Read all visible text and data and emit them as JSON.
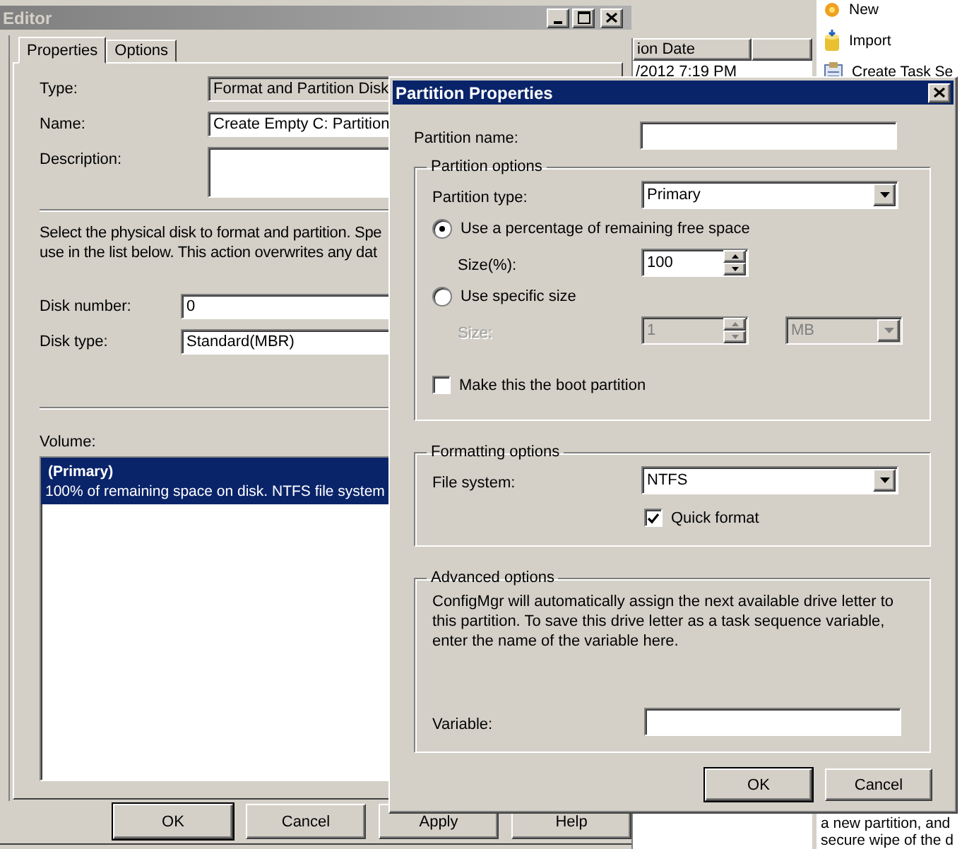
{
  "background": {
    "actions": [
      {
        "label": "New"
      },
      {
        "label": "Import"
      },
      {
        "label": "Create Task Se"
      }
    ],
    "list": {
      "columns": [
        "ion Date"
      ],
      "rows": [
        "/2012 7:19 PM"
      ]
    },
    "description": [
      "a new partition, and",
      "secure wipe of the d"
    ]
  },
  "editor": {
    "title": "Editor",
    "tabs": [
      {
        "label": "Properties",
        "selected": true
      },
      {
        "label": "Options",
        "selected": false
      }
    ],
    "fields": [
      {
        "label": "Type:",
        "value": "Format and Partition Disk",
        "readonly": true,
        "multiline": false
      },
      {
        "label": "Name:",
        "value": "Create Empty C: Partition",
        "readonly": false,
        "multiline": false
      },
      {
        "label": "Description:",
        "readonly": false,
        "multiline": true
      }
    ],
    "instructions": [
      "Select the physical disk to format and partition. Spe",
      "use in the list below. This action overwrites any dat"
    ],
    "disk_fields": [
      {
        "label": "Disk number:",
        "value": "0"
      },
      {
        "label": "Disk type:",
        "value": "Standard(MBR)"
      }
    ],
    "volume": {
      "label": "Volume:",
      "items": [
        {
          "title": "(Primary)",
          "detail": "100% of remaining space on disk. NTFS file system",
          "selected": true
        }
      ]
    },
    "buttons": [
      "OK",
      "Cancel",
      "Apply",
      "Help"
    ]
  },
  "dialog": {
    "title": "Partition Properties",
    "name_label": "Partition name:",
    "groups": [
      {
        "title": "Partition options",
        "rows": [
          {
            "kind": "select",
            "label": "Partition type:",
            "value": "Primary",
            "disabled": false
          },
          {
            "kind": "radio",
            "label": "Use a percentage of remaining free space",
            "selected": true
          },
          {
            "kind": "spin",
            "label": "Size(%):",
            "value": "100",
            "disabled": false
          },
          {
            "kind": "radio",
            "label": "Use specific size",
            "selected": false
          },
          {
            "kind": "spin",
            "label": "Size:",
            "value": "1",
            "unit": "MB",
            "disabled": true
          },
          {
            "kind": "checkbox",
            "label": "Make this the boot partition",
            "checked": false
          }
        ]
      },
      {
        "title": "Formatting options",
        "rows": [
          {
            "kind": "select",
            "label": "File system:",
            "value": "NTFS",
            "disabled": false
          },
          {
            "kind": "option",
            "label": "Quick format",
            "checked": true
          }
        ]
      },
      {
        "title": "Advanced options",
        "rows": [
          {
            "kind": "text",
            "text": "ConfigMgr will automatically assign the next available drive letter to this partition. To save this drive letter as a task sequence variable, enter the name of the variable here."
          },
          {
            "kind": "input",
            "label": "Variable:"
          }
        ]
      }
    ],
    "buttons": [
      "OK",
      "Cancel"
    ]
  }
}
